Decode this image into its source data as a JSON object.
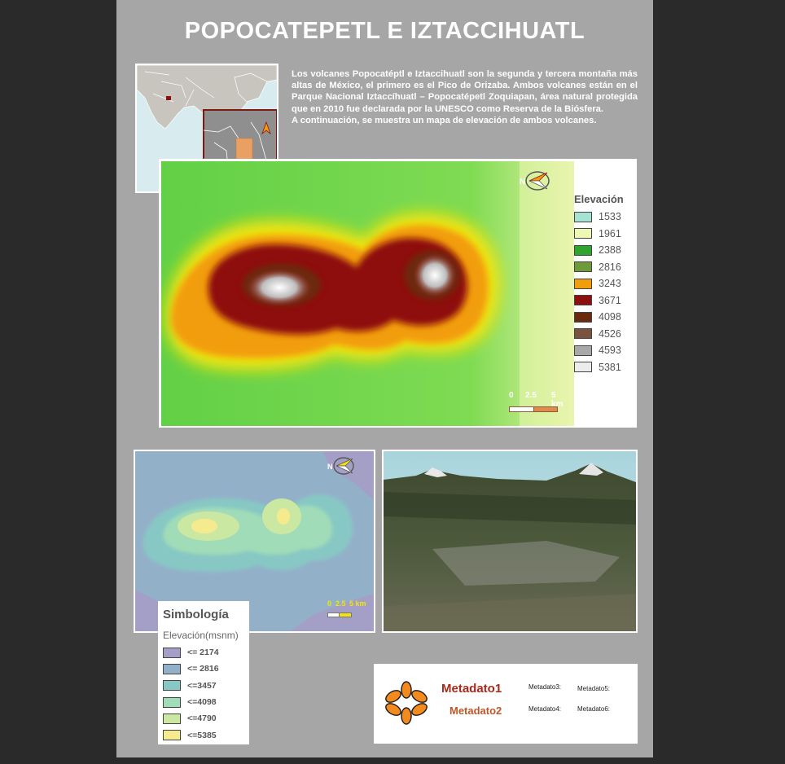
{
  "title": "POPOCATEPETL E IZTACCIHUATL",
  "intro": {
    "paragraph1": "Los volcanes Popocatéptl e Iztaccihuatl son la segunda y tercera montaña más altas de México, el primero es el Pico de Orizaba. Ambos volcanes están en el Parque Nacional Iztaccíhuatl – Popocatépetl Zoquiapan, área natural protegida que en 2010 fue declarada por la UNESCO como Reserva de la Biósfera.",
    "paragraph2": "A continuación, se muestra un mapa de elevación de ambos volcanes."
  },
  "elevation_legend": {
    "title": "Elevación",
    "items": [
      {
        "label": "1533",
        "color": "#a6e3d3"
      },
      {
        "label": "1961",
        "color": "#eef7b4"
      },
      {
        "label": "2388",
        "color": "#2fa52f"
      },
      {
        "label": "2816",
        "color": "#6e9a3a"
      },
      {
        "label": "3243",
        "color": "#f29d0c"
      },
      {
        "label": "3671",
        "color": "#8e0f0f"
      },
      {
        "label": "4098",
        "color": "#6a2a10"
      },
      {
        "label": "4526",
        "color": "#7a5240"
      },
      {
        "label": "4593",
        "color": "#a8a8a8"
      },
      {
        "label": "5381",
        "color": "#ececec"
      }
    ]
  },
  "main_scale": {
    "t0": "0",
    "t1": "2.5",
    "t2": "5 km"
  },
  "small_scale": {
    "t0": "0",
    "t1": "2.5",
    "t2": "5 km"
  },
  "simbologia": {
    "title": "Simbología",
    "subtitle": "Elevación(msnm)",
    "items": [
      {
        "label": "<= 2174",
        "color": "#a49fc6"
      },
      {
        "label": "<= 2816",
        "color": "#93b0c9"
      },
      {
        "label": "<=3457",
        "color": "#87c8c4"
      },
      {
        "label": "<=4098",
        "color": "#a1dcb8"
      },
      {
        "label": "<=4790",
        "color": "#cbe8a2"
      },
      {
        "label": "<=5385",
        "color": "#f6ea8e"
      }
    ]
  },
  "metadata": {
    "meta1": "Metadato1",
    "meta2": "Metadato2",
    "meta3": "Metadato3:",
    "meta4": "Metadato4:",
    "meta5": "Metadato5:",
    "meta6": "Metadato6:"
  },
  "colors": {
    "sheet": "#a6a6a6",
    "logo": "#f28a1e",
    "meta_title": "#a52a1a"
  },
  "icons": [
    "north-arrow-icon",
    "logo-flower-icon"
  ]
}
